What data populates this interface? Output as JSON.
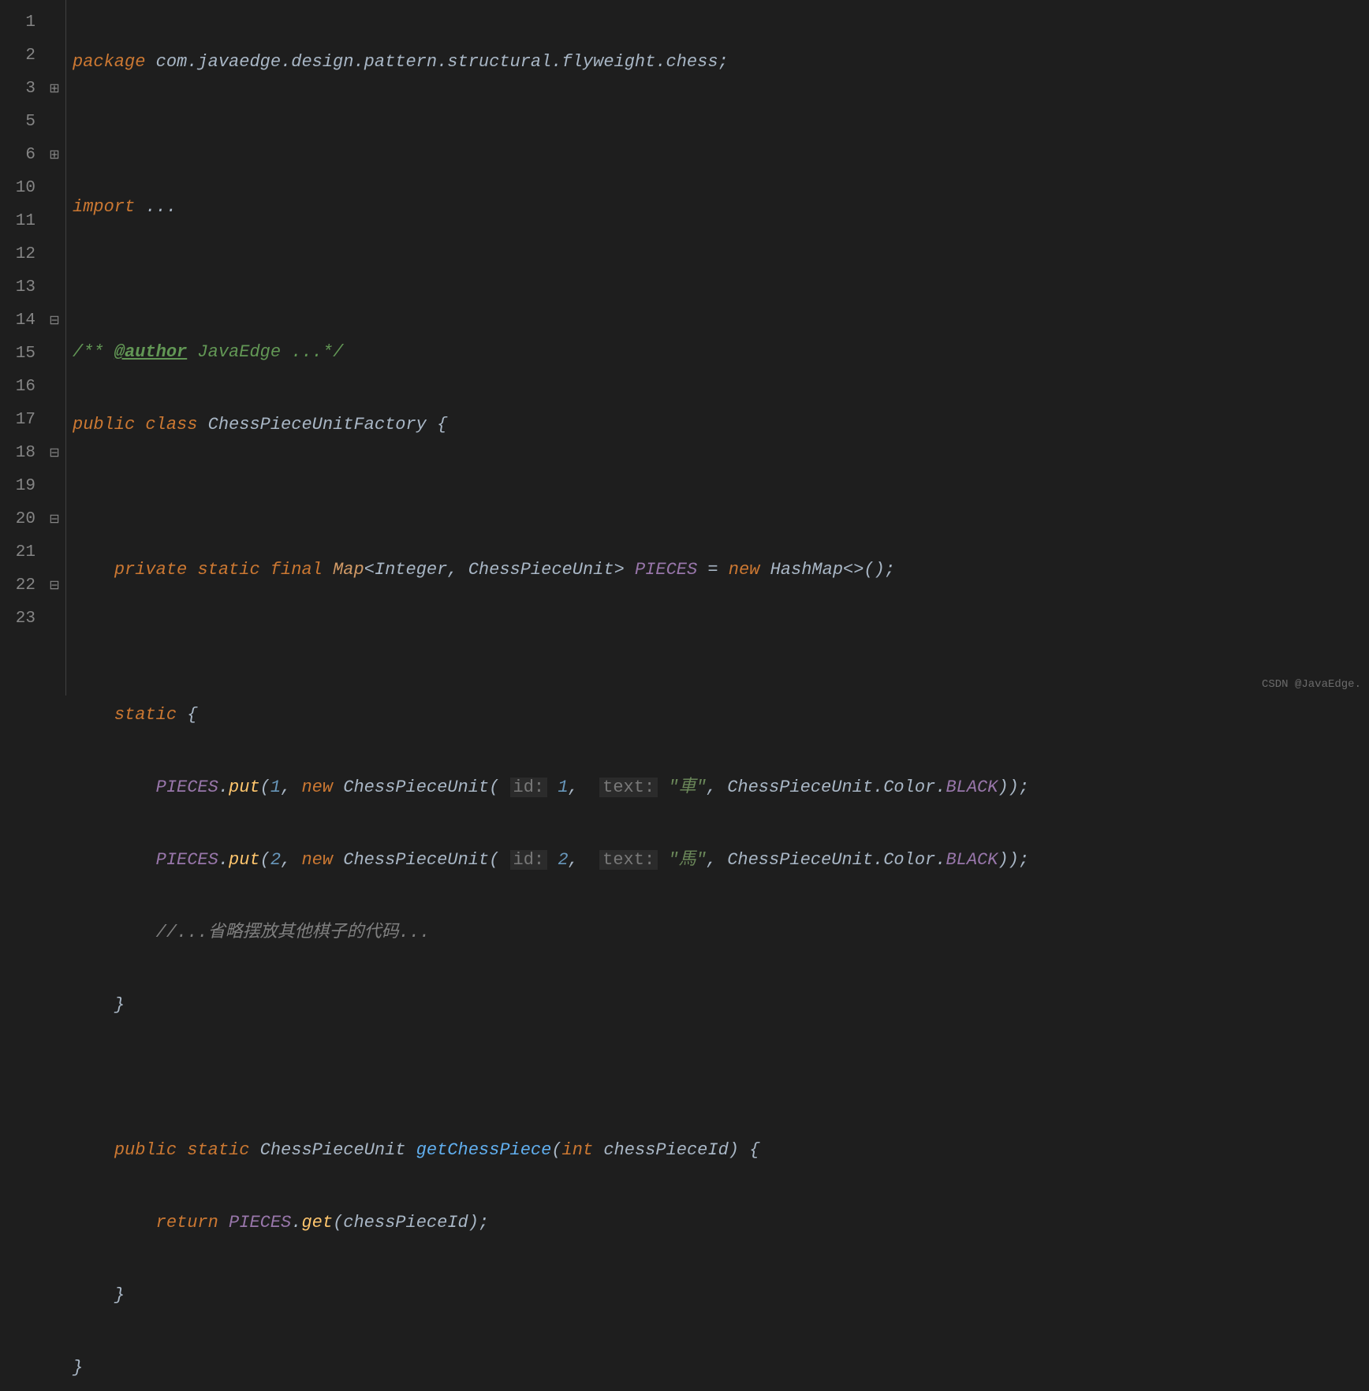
{
  "lineNumbers": [
    "1",
    "2",
    "3",
    "5",
    "6",
    "10",
    "11",
    "12",
    "13",
    "14",
    "15",
    "16",
    "17",
    "18",
    "19",
    "20",
    "21",
    "22",
    "23"
  ],
  "foldMarkers": [
    "",
    "",
    "⊞",
    "",
    "⊞",
    "",
    "",
    "",
    "",
    "⊟",
    "",
    "",
    "",
    "⊟",
    "",
    "⊟",
    "",
    "⊟",
    ""
  ],
  "code": {
    "package_kw": "package",
    "package_name": "com.javaedge.design.pattern.structural.flyweight.chess",
    "import_kw": "import",
    "import_rest": "...",
    "doc_open": "/** ",
    "doc_tag": "@author",
    "doc_author": " JavaEdge ...*/",
    "public_kw": "public",
    "class_kw": "class",
    "class_name": "ChessPieceUnitFactory",
    "private_kw": "private",
    "static_kw": "static",
    "final_kw": "final",
    "map_type": "Map",
    "int_type": "Integer",
    "unit_type": "ChessPieceUnit",
    "field_name": "PIECES",
    "new_kw": "new",
    "hashmap": "HashMap",
    "diamondop": "<>();",
    "put_method": "put",
    "id_hint1": "id:",
    "id_val1": "1",
    "text_hint1": "text:",
    "text_val1": "\"車\"",
    "color_path": "ChessPieceUnit.Color.",
    "black": "BLACK",
    "id_hint2": "id:",
    "id_val2": "2",
    "text_hint2": "text:",
    "text_val2": "\"馬\"",
    "comment_omit": "//...省略摆放其他棋子的代码...",
    "get_method_name": "getChessPiece",
    "int_kw": "int",
    "param_name": "chessPieceId",
    "return_kw": "return",
    "get_call": "get"
  },
  "watermark": "CSDN @JavaEdge."
}
